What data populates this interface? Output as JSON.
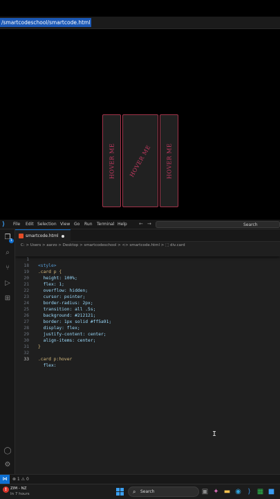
{
  "browser": {
    "url": "/smartcodeschool/smartcode.html"
  },
  "preview": {
    "cards": [
      {
        "label": "HOVER ME"
      },
      {
        "label": "HOVER ME"
      },
      {
        "label": "HOVER ME"
      }
    ],
    "colors": {
      "card_bg": "#212121",
      "card_border": "#a3334a",
      "text": "#c83a62"
    }
  },
  "vscode": {
    "menu": [
      "File",
      "Edit",
      "Selection",
      "View",
      "Go",
      "Run",
      "Terminal",
      "Help"
    ],
    "search_label": "Search",
    "tab": {
      "name": "smartcode.html",
      "modified": true
    },
    "breadcrumb": "C: > Users > aarzo > Desktop > smartcodeschool > <> smartcode.html > ⬚ div.card",
    "lines": [
      {
        "n": "1",
        "text": "<style>"
      },
      {
        "n": "18",
        "text": ".card p {"
      },
      {
        "n": "19",
        "text": "  height: 100%;"
      },
      {
        "n": "20",
        "text": "  flex: 1;"
      },
      {
        "n": "21",
        "text": "  overflow: hidden;"
      },
      {
        "n": "22",
        "text": "  cursor: pointer;"
      },
      {
        "n": "23",
        "text": "  border-radius: 2px;"
      },
      {
        "n": "24",
        "text": "  transition: all .5s;"
      },
      {
        "n": "25",
        "text": "  background: #212121;"
      },
      {
        "n": "26",
        "text": "  border: 1px solid #ff5a91;"
      },
      {
        "n": "27",
        "text": "  display: flex;"
      },
      {
        "n": "28",
        "text": "  justify-content: center;"
      },
      {
        "n": "29",
        "text": "  align-items: center;"
      },
      {
        "n": "30",
        "text": "}"
      },
      {
        "n": "31",
        "text": ""
      },
      {
        "n": "32",
        "text": ".card p:hover"
      },
      {
        "n": "33",
        "text": "  flex:"
      }
    ],
    "status": "⊗ 1 ⚠ 0",
    "accent": "#0e6fd1"
  },
  "taskbar": {
    "weather_line1": "ZIM - NZ",
    "weather_line2": "In 7 hours",
    "search_label": "Search"
  }
}
